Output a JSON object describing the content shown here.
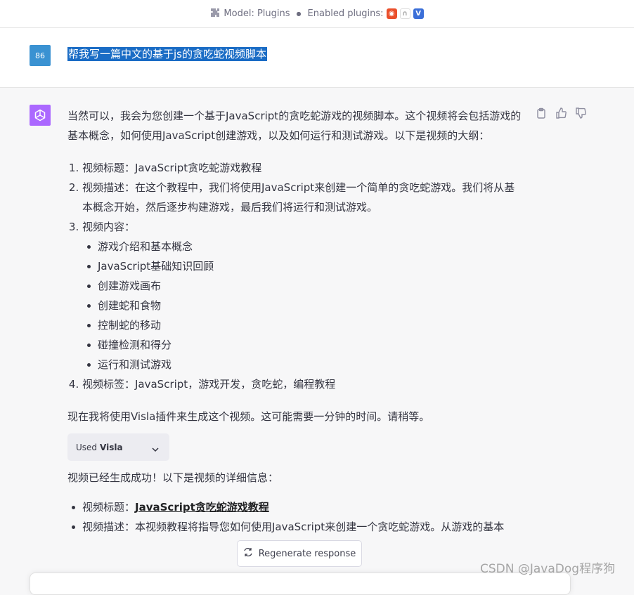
{
  "topbar": {
    "model_label": "Model: Plugins",
    "enabled_label": "Enabled plugins:",
    "plugin_icons": [
      "plugin-1-icon",
      "plugin-2-icon",
      "visla-plugin-icon"
    ]
  },
  "user": {
    "avatar_text": "86",
    "message": "帮我写一篇中文的基于js的贪吃蛇视频脚本"
  },
  "assistant": {
    "intro": "当然可以，我会为您创建一个基于JavaScript的贪吃蛇游戏的视频脚本。这个视频将会包括游戏的基本概念，如何使用JavaScript创建游戏，以及如何运行和测试游戏。以下是视频的大纲：",
    "outline": [
      "视频标题：JavaScript贪吃蛇游戏教程",
      "视频描述：在这个教程中，我们将使用JavaScript来创建一个简单的贪吃蛇游戏。我们将从基本概念开始，然后逐步构建游戏，最后我们将运行和测试游戏。",
      "视频内容：",
      "视频标签：JavaScript，游戏开发，贪吃蛇，编程教程"
    ],
    "content_items": [
      "游戏介绍和基本概念",
      "JavaScript基础知识回顾",
      "创建游戏画布",
      "创建蛇和食物",
      "控制蛇的移动",
      "碰撞检测和得分",
      "运行和测试游戏"
    ],
    "plugin_note": "现在我将使用Visla插件来生成这个视频。这可能需要一分钟的时间。请稍等。",
    "used_prefix": "Used",
    "used_plugin": "Visla",
    "result_intro": "视频已经生成成功！以下是视频的详细信息：",
    "detail_title_label": "视频标题：",
    "detail_title_link": "JavaScript贪吃蛇游戏教程",
    "detail_desc": "视频描述：本视频教程将指导您如何使用JavaScript来创建一个贪吃蛇游戏。从游戏的基本"
  },
  "regenerate_label": "Regenerate response",
  "watermark": "CSDN @JavaDog程序狗",
  "colors": {
    "user_avatar": "#3a92d2",
    "bot_avatar": "#ab68ff",
    "selection": "#1a6cc5"
  }
}
